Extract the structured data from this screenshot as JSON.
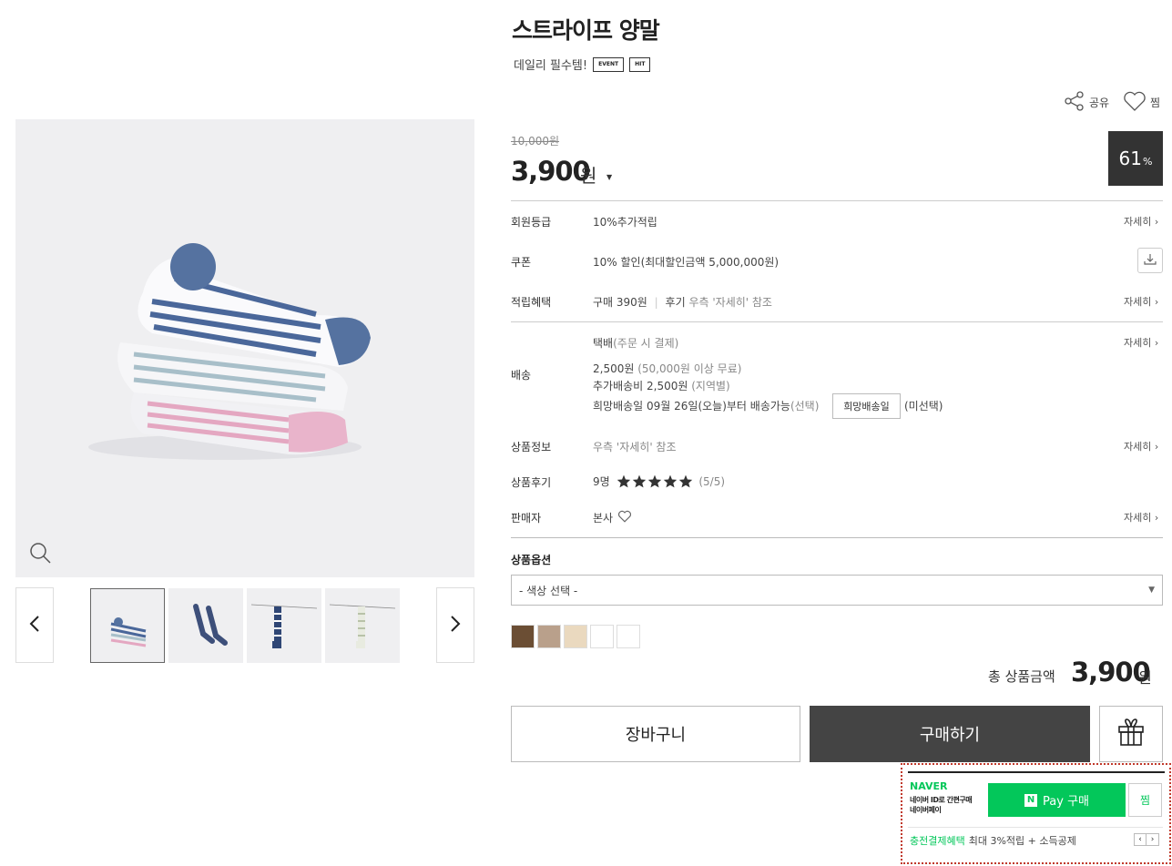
{
  "product": {
    "title": "스트라이프 양말",
    "subtitle": "데일리 필수템!",
    "badges": [
      "EVENT",
      "HIT"
    ]
  },
  "actions": {
    "share_label": "공유",
    "wish_label": "찜"
  },
  "price": {
    "original": "10,000",
    "original_unit": "원",
    "sale": "3,900",
    "sale_unit": "원",
    "discount": "61",
    "discount_unit": "%"
  },
  "info": {
    "member": {
      "label": "회원등급",
      "value": "10%추가적립",
      "more": "자세히 ›"
    },
    "coupon": {
      "label": "쿠폰",
      "value": "10% 할인(최대할인금액 5,000,000원)"
    },
    "points": {
      "label": "적립혜택",
      "buy": "구매 390원",
      "sep": "|",
      "review_key": "후기",
      "review_val": "우측 '자세히' 참조",
      "more": "자세히 ›"
    },
    "shipping": {
      "label": "배송",
      "method": "택배",
      "method_note": "(주문 시 결제)",
      "fee": "2,500원",
      "fee_note": "(50,000원 이상 무료)",
      "extra": "추가배송비 2,500원",
      "extra_note": "(지역별)",
      "date_text": "희망배송일 09월 26일(오늘)부터 배송가능",
      "date_note": "(선택)",
      "date_button": "희망배송일",
      "date_status": "(미선택)",
      "more": "자세히 ›"
    },
    "product_info": {
      "label": "상품정보",
      "value": "우측 '자세히' 참조",
      "more": "자세히 ›"
    },
    "review": {
      "label": "상품후기",
      "count": "9명",
      "rating": 5,
      "score": "(5/5)"
    },
    "seller": {
      "label": "판매자",
      "value": "본사",
      "more": "자세히 ›"
    }
  },
  "options": {
    "label": "상품옵션",
    "select_value": "- 색상 선택 -",
    "swatches": [
      "#6b4e34",
      "#b9a08b",
      "#ead9bf",
      "#ffffff",
      "#ffffff"
    ]
  },
  "total": {
    "label": "총 상품금액",
    "value": "3,900",
    "unit": "원"
  },
  "buttons": {
    "cart": "장바구니",
    "buy": "구매하기"
  },
  "npay": {
    "logo": "NAVER",
    "line1": "네이버 ID로 간편구매",
    "line2": "네이버페이",
    "buy_badge": "N",
    "buy_label": "Pay 구매",
    "wish_label": "찜",
    "benefit_key": "충전결제혜택",
    "benefit_val": "최대 3%적립 + 소득공제",
    "prev": "‹",
    "next": "›"
  },
  "icons": [
    "share-icon",
    "heart-icon",
    "zoom-icon",
    "chevron-left-icon",
    "chevron-right-icon",
    "download-icon",
    "star-icon",
    "gift-icon",
    "caret-down-icon"
  ]
}
